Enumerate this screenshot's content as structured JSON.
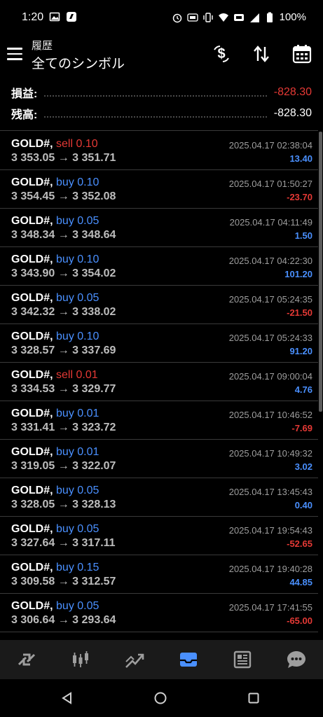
{
  "status_bar": {
    "time": "1:20",
    "battery": "100%"
  },
  "header": {
    "subtitle": "履歴",
    "title": "全てのシンボル"
  },
  "summary": {
    "profit_label": "損益:",
    "profit_value": "-828.30",
    "balance_label": "残高:",
    "balance_value": "-828.30"
  },
  "trades": [
    {
      "symbol": "GOLD#,",
      "side": "sell",
      "volume": "0.10",
      "prices": "3 353.05 → 3 351.71",
      "time": "2025.04.17 02:38:04",
      "profit": "13.40"
    },
    {
      "symbol": "GOLD#,",
      "side": "buy",
      "volume": "0.10",
      "prices": "3 354.45 → 3 352.08",
      "time": "2025.04.17 01:50:27",
      "profit": "-23.70"
    },
    {
      "symbol": "GOLD#,",
      "side": "buy",
      "volume": "0.05",
      "prices": "3 348.34 → 3 348.64",
      "time": "2025.04.17 04:11:49",
      "profit": "1.50"
    },
    {
      "symbol": "GOLD#,",
      "side": "buy",
      "volume": "0.10",
      "prices": "3 343.90 → 3 354.02",
      "time": "2025.04.17 04:22:30",
      "profit": "101.20"
    },
    {
      "symbol": "GOLD#,",
      "side": "buy",
      "volume": "0.05",
      "prices": "3 342.32 → 3 338.02",
      "time": "2025.04.17 05:24:35",
      "profit": "-21.50"
    },
    {
      "symbol": "GOLD#,",
      "side": "buy",
      "volume": "0.10",
      "prices": "3 328.57 → 3 337.69",
      "time": "2025.04.17 05:24:33",
      "profit": "91.20"
    },
    {
      "symbol": "GOLD#,",
      "side": "sell",
      "volume": "0.01",
      "prices": "3 334.53 → 3 329.77",
      "time": "2025.04.17 09:00:04",
      "profit": "4.76"
    },
    {
      "symbol": "GOLD#,",
      "side": "buy",
      "volume": "0.01",
      "prices": "3 331.41 → 3 323.72",
      "time": "2025.04.17 10:46:52",
      "profit": "-7.69"
    },
    {
      "symbol": "GOLD#,",
      "side": "buy",
      "volume": "0.01",
      "prices": "3 319.05 → 3 322.07",
      "time": "2025.04.17 10:49:32",
      "profit": "3.02"
    },
    {
      "symbol": "GOLD#,",
      "side": "buy",
      "volume": "0.05",
      "prices": "3 328.05 → 3 328.13",
      "time": "2025.04.17 13:45:43",
      "profit": "0.40"
    },
    {
      "symbol": "GOLD#,",
      "side": "buy",
      "volume": "0.05",
      "prices": "3 327.64 → 3 317.11",
      "time": "2025.04.17 19:54:43",
      "profit": "-52.65"
    },
    {
      "symbol": "GOLD#,",
      "side": "buy",
      "volume": "0.15",
      "prices": "3 309.58 → 3 312.57",
      "time": "2025.04.17 19:40:28",
      "profit": "44.85"
    },
    {
      "symbol": "GOLD#,",
      "side": "buy",
      "volume": "0.05",
      "prices": "3 306.64 → 3 293.64",
      "time": "2025.04.17 17:41:55",
      "profit": "-65.00"
    }
  ],
  "bottom_nav": [
    {
      "icon": "quotes-icon",
      "active": false
    },
    {
      "icon": "candlestick-chart-icon",
      "active": false
    },
    {
      "icon": "trade-icon",
      "active": false
    },
    {
      "icon": "history-inbox-icon",
      "active": true
    },
    {
      "icon": "news-icon",
      "active": false
    },
    {
      "icon": "chat-icon",
      "active": false
    }
  ],
  "colors": {
    "background": "#000000",
    "negative": "#e53935",
    "positive": "#4a90ff",
    "active_nav": "#4a90ff",
    "inactive_nav": "#9e9e9e"
  }
}
